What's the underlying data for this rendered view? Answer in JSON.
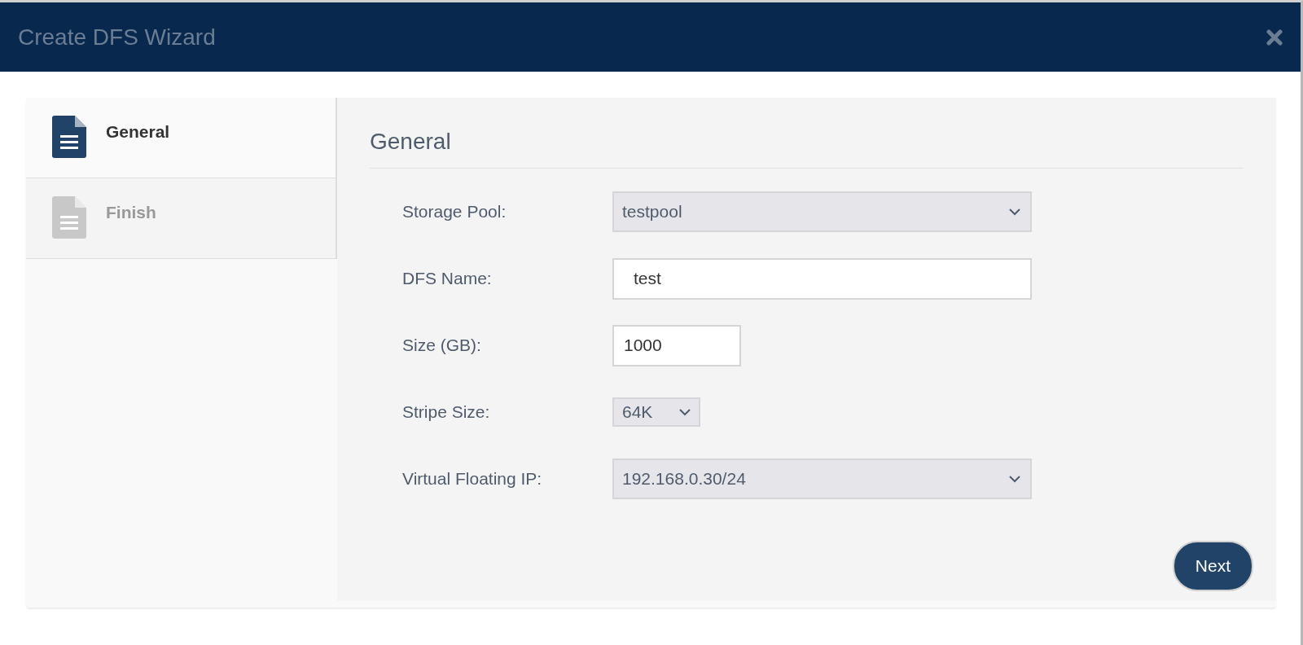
{
  "window": {
    "title": "Create DFS Wizard"
  },
  "steps": [
    {
      "label": "General",
      "selected": true
    },
    {
      "label": "Finish",
      "selected": false
    }
  ],
  "form": {
    "heading": "General",
    "fields": [
      {
        "label": "Storage Pool:",
        "kind": "select",
        "value": "testpool"
      },
      {
        "label": "DFS Name:",
        "kind": "text",
        "value": "test"
      },
      {
        "label": "Size (GB):",
        "kind": "number",
        "value": "1000"
      },
      {
        "label": "Stripe Size:",
        "kind": "compact",
        "value": "64K"
      },
      {
        "label": "Virtual Floating IP:",
        "kind": "select",
        "value": "192.168.0.30/24"
      }
    ]
  },
  "buttons": [
    "Next"
  ]
}
